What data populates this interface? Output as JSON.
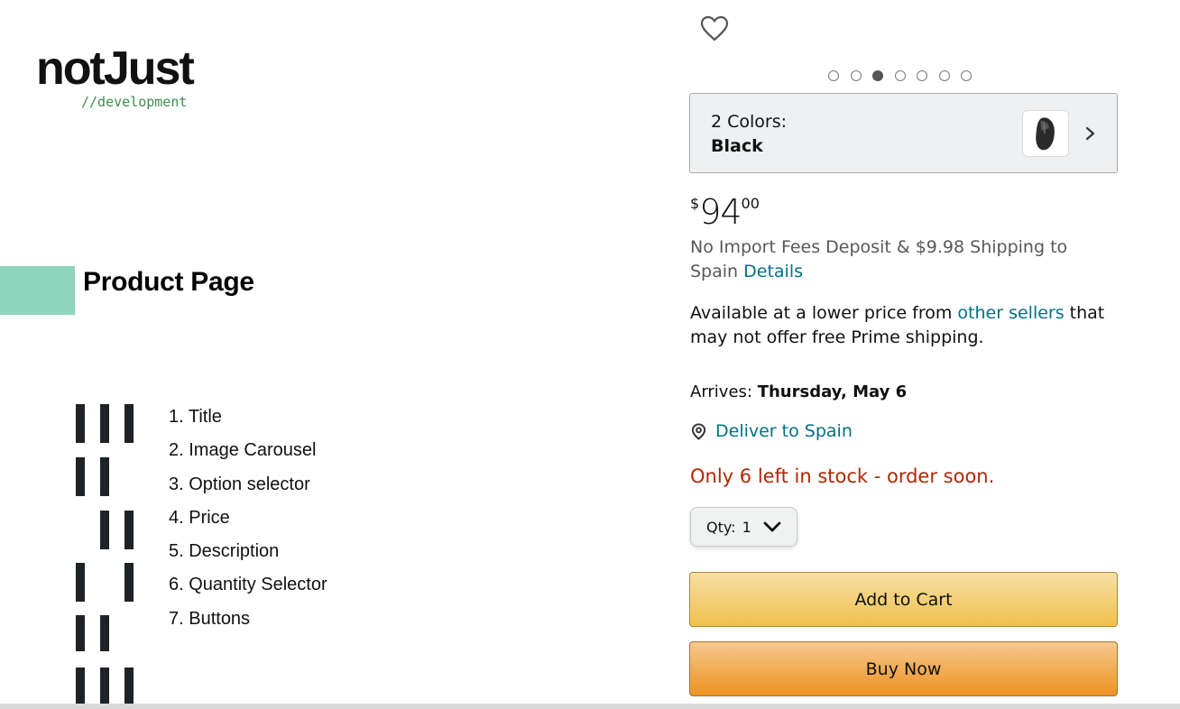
{
  "colors": {
    "accent_block": "#8fd5bd",
    "logo_sub": "#3d8d4f",
    "link": "#007185",
    "stock_warning": "#b12704",
    "add_to_cart": "#f0c14b",
    "buy_now": "#ed9220"
  },
  "logo": {
    "main": "notJust",
    "sub": "//development"
  },
  "slide": {
    "title": "Product Page",
    "outline": [
      "1. Title",
      "2. Image Carousel",
      "3. Option selector",
      "4. Price",
      "5. Description",
      "6. Quantity Selector",
      "7. Buttons"
    ]
  },
  "product": {
    "wishlist_icon": "heart-outline-icon",
    "carousel": {
      "total": 7,
      "active_index": 2
    },
    "color_selector": {
      "label": "2 Colors:",
      "value": "Black",
      "thumbnail_icon": "mouse-icon",
      "chevron_icon": "chevron-right-icon"
    },
    "price": {
      "currency": "$",
      "whole": "94",
      "fraction": "00"
    },
    "shipping": {
      "text": "No Import Fees Deposit & $9.98 Shipping to Spain ",
      "link": "Details"
    },
    "availability": {
      "before": "Available at a lower price from ",
      "link": "other sellers",
      "after": " that may not offer free Prime shipping."
    },
    "arrives": {
      "label": "Arrives: ",
      "date": "Thursday, May 6"
    },
    "deliver": {
      "icon": "location-pin-icon",
      "text": "Deliver to Spain"
    },
    "stock": "Only 6 left in stock - order soon.",
    "quantity": {
      "label": "Qty:",
      "value": "1",
      "icon": "chevron-down-icon"
    },
    "buttons": {
      "add_to_cart": "Add to Cart",
      "buy_now": "Buy Now"
    }
  }
}
